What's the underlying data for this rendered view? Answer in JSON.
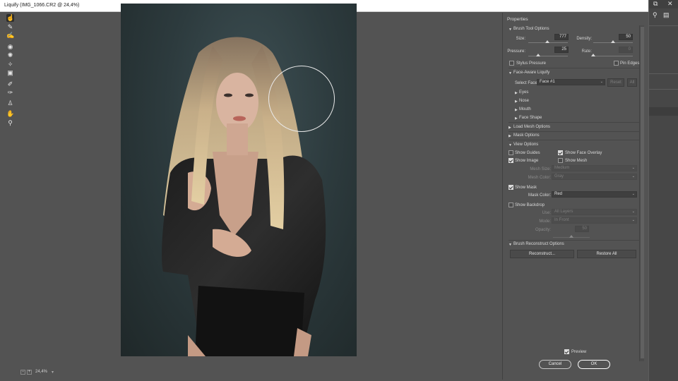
{
  "window": {
    "title": "Liquify (IMG_1066.CR2 @ 24,4%)"
  },
  "toolbar": {
    "tools": [
      {
        "name": "forward-warp-tool",
        "glyph": "☝"
      },
      {
        "name": "reconstruct-tool",
        "glyph": "✎"
      },
      {
        "name": "smooth-tool",
        "glyph": "✍"
      },
      {
        "name": "twirl-clockwise-tool",
        "glyph": "◉"
      },
      {
        "name": "pucker-tool",
        "glyph": "✺"
      },
      {
        "name": "bloat-tool",
        "glyph": "✧"
      },
      {
        "name": "push-left-tool",
        "glyph": "▣"
      },
      {
        "name": "freeze-mask-tool",
        "glyph": "✐"
      },
      {
        "name": "thaw-mask-tool",
        "glyph": "✑"
      },
      {
        "name": "face-tool",
        "glyph": "♙"
      },
      {
        "name": "hand-tool",
        "glyph": "✋"
      },
      {
        "name": "zoom-tool",
        "glyph": "⚲"
      }
    ]
  },
  "status": {
    "zoom": "24,4%",
    "zoom_minus": "−",
    "zoom_plus": "+",
    "zoom_arrow": "▾"
  },
  "panel": {
    "title": "Properties",
    "brush": {
      "header": "Brush Tool Options",
      "size_label": "Size:",
      "size_value": "777",
      "size_level": 0.48,
      "density_label": "Density:",
      "density_value": "50",
      "density_level": 0.5,
      "pressure_label": "Pressure:",
      "pressure_value": "25",
      "pressure_level": 0.25,
      "rate_label": "Rate:",
      "rate_value": "0",
      "rate_level": 0.0,
      "stylus_label": "Stylus Pressure",
      "stylus_checked": false,
      "pin_edges_label": "Pin Edges",
      "pin_edges_checked": false
    },
    "face": {
      "header": "Face-Aware Liquify",
      "select_face_label": "Select Face:",
      "select_face_value": "Face #1",
      "reset_label": "Reset",
      "all_label": "All",
      "items": [
        "Eyes",
        "Nose",
        "Mouth",
        "Face Shape"
      ]
    },
    "load_mesh": {
      "header": "Load Mesh Options"
    },
    "mask": {
      "header": "Mask Options"
    },
    "view": {
      "header": "View Options",
      "show_guides": "Show Guides",
      "show_guides_checked": false,
      "show_face_overlay": "Show Face Overlay",
      "show_face_overlay_checked": true,
      "show_image": "Show Image",
      "show_image_checked": true,
      "show_mesh": "Show Mesh",
      "show_mesh_checked": false,
      "mesh_size_label": "Mesh Size:",
      "mesh_size_value": "Medium",
      "mesh_color_label": "Mesh Color:",
      "mesh_color_value": "Gray",
      "show_mask": "Show Mask",
      "show_mask_checked": true,
      "mask_color_label": "Mask Color:",
      "mask_color_value": "Red",
      "show_backdrop": "Show Backdrop",
      "show_backdrop_checked": false,
      "use_label": "Use:",
      "use_value": "All Layers",
      "mode_label": "Mode:",
      "mode_value": "In Front",
      "opacity_label": "Opacity:",
      "opacity_value": "50",
      "opacity_level": 0.5
    },
    "reconstruct": {
      "header": "Brush Reconstruct Options",
      "reconstruct_label": "Reconstruct...",
      "restore_all_label": "Restore All"
    },
    "preview_label": "Preview",
    "preview_checked": true,
    "cancel_label": "Cancel",
    "ok_label": "OK"
  },
  "colors": {
    "panel_bg": "#535353",
    "titlebar_bg": "#ffffff",
    "photo_bg": "#2d3b3e"
  }
}
